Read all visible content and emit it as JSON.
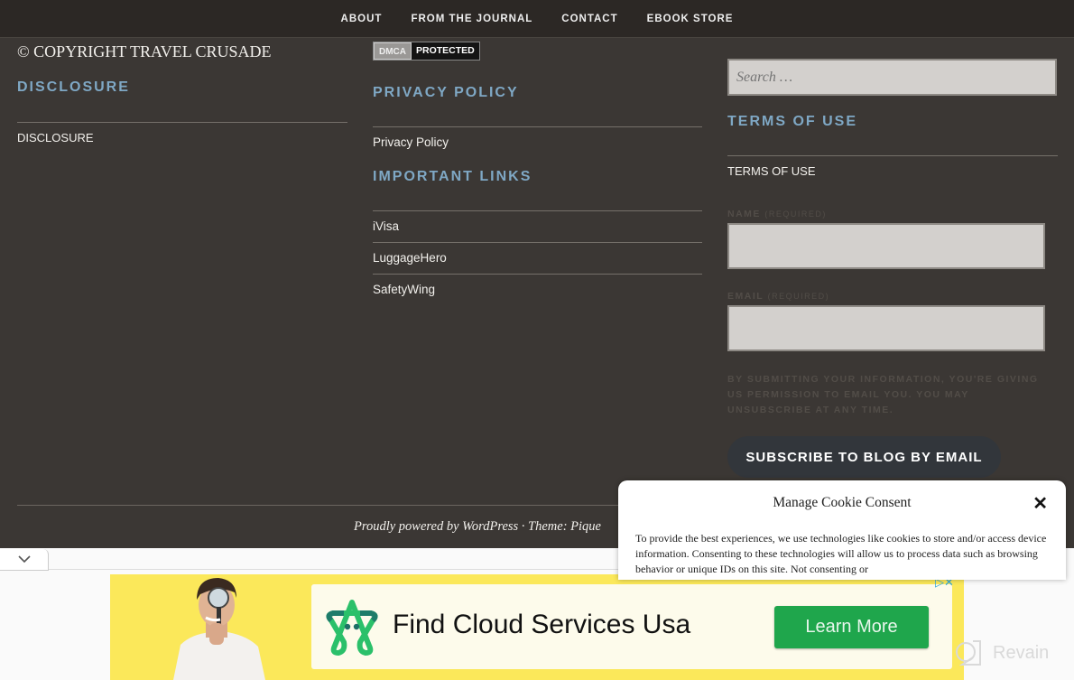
{
  "nav": {
    "items": [
      "ABOUT",
      "FROM THE JOURNAL",
      "CONTACT",
      "EBOOK STORE"
    ]
  },
  "col1": {
    "copyright": "© COPYRIGHT TRAVEL CRUSADE",
    "disclosure_title": "DISCLOSURE",
    "disclosure_link": "DISCLOSURE"
  },
  "col2": {
    "dmca_left": "DMCA",
    "dmca_right": "PROTECTED",
    "privacy_title": "PRIVACY POLICY",
    "privacy_link": "Privacy Policy",
    "important_title": "IMPORTANT LINKS",
    "important_links": [
      "iVisa",
      "LuggageHero",
      "SafetyWing"
    ]
  },
  "col3": {
    "search_placeholder": "Search …",
    "terms_title": "TERMS OF USE",
    "terms_link": "TERMS OF USE",
    "name_label": "NAME",
    "name_required": "(REQUIRED)",
    "email_label": "EMAIL",
    "email_required": "(REQUIRED)",
    "fine_print": "BY SUBMITTING YOUR INFORMATION, YOU'RE GIVING US PERMISSION TO EMAIL YOU. YOU MAY UNSUBSCRIBE AT ANY TIME.",
    "subscribe_label": "SUBSCRIBE TO BLOG BY EMAIL"
  },
  "footer": {
    "powered": "Proudly powered by WordPress · Theme: Pique"
  },
  "cookie": {
    "title": "Manage Cookie Consent",
    "close": "✕",
    "body": "To provide the best experiences, we use technologies like cookies to store and/or access device information. Consenting to these technologies will allow us to process data such as browsing behavior or unique IDs on this site. Not consenting or"
  },
  "ad": {
    "title": "Find Cloud Services Usa",
    "button": "Learn More",
    "choices": "▷✕",
    "colors": {
      "background": "#fbe85a",
      "button": "#1fa64c"
    }
  },
  "watermark": {
    "text": "Revain"
  }
}
